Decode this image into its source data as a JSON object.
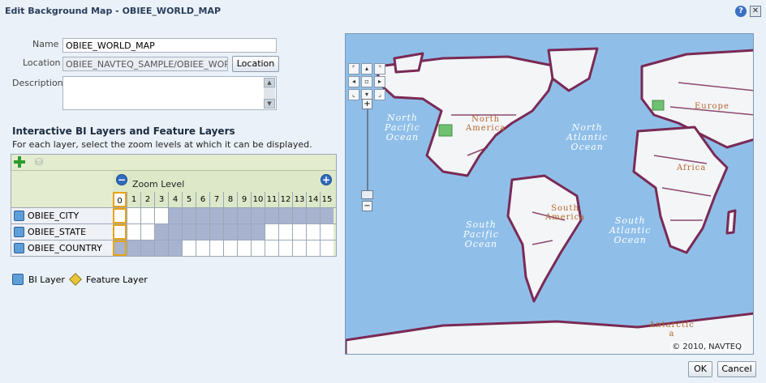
{
  "dialog": {
    "title": "Edit Background Map - OBIEE_WORLD_MAP",
    "help_icon": "question-icon",
    "close_icon": "close-icon"
  },
  "form": {
    "name_label": "Name",
    "name_value": "OBIEE_WORLD_MAP",
    "location_label": "Location",
    "location_value": "OBIEE_NAVTEQ_SAMPLE/OBIEE_WORLD_",
    "location_button": "Location",
    "description_label": "Description",
    "description_value": ""
  },
  "layers_section": {
    "title": "Interactive BI Layers and Feature Layers",
    "description": "For each layer, select the zoom levels at which it can be displayed.",
    "zoom_header": "Zoom Level",
    "zoom_levels": [
      "0",
      "1",
      "2",
      "3",
      "4",
      "5",
      "6",
      "7",
      "8",
      "9",
      "10",
      "11",
      "12",
      "13",
      "14",
      "15"
    ],
    "selected_zoom": 0,
    "rows": [
      {
        "name": "OBIEE_CITY",
        "enabled_levels": [
          4,
          5,
          6,
          7,
          8,
          9,
          10,
          11,
          12,
          13,
          14,
          15
        ]
      },
      {
        "name": "OBIEE_STATE",
        "enabled_levels": [
          3,
          4,
          5,
          6,
          7,
          8,
          9,
          10
        ]
      },
      {
        "name": "OBIEE_COUNTRY",
        "enabled_levels": [
          0,
          1,
          2,
          3,
          4
        ]
      }
    ]
  },
  "legend": {
    "bi_layer": "BI Layer",
    "feature_layer": "Feature Layer"
  },
  "map": {
    "labels": {
      "north_pacific": "North\nPacific\nOcean",
      "north_america": "North\nAmerica",
      "north_atlantic": "North\nAtlantic\nOcean",
      "south_pacific": "South\nPacific\nOcean",
      "south_america": "South\nAmerica",
      "south_atlantic": "South\nAtlantic\nOcean",
      "africa": "Africa",
      "europe": "Europe",
      "antarctica": "Antarctic\na"
    },
    "copyright": "© 2010, NAVTEQ"
  },
  "footer": {
    "ok": "OK",
    "cancel": "Cancel"
  },
  "colors": {
    "enabled_cell": "#a7b3cf",
    "selected_border": "#e8a315",
    "ocean": "#8fbfe9",
    "land": "#f3f5f7",
    "borders": "#7a2a55"
  }
}
